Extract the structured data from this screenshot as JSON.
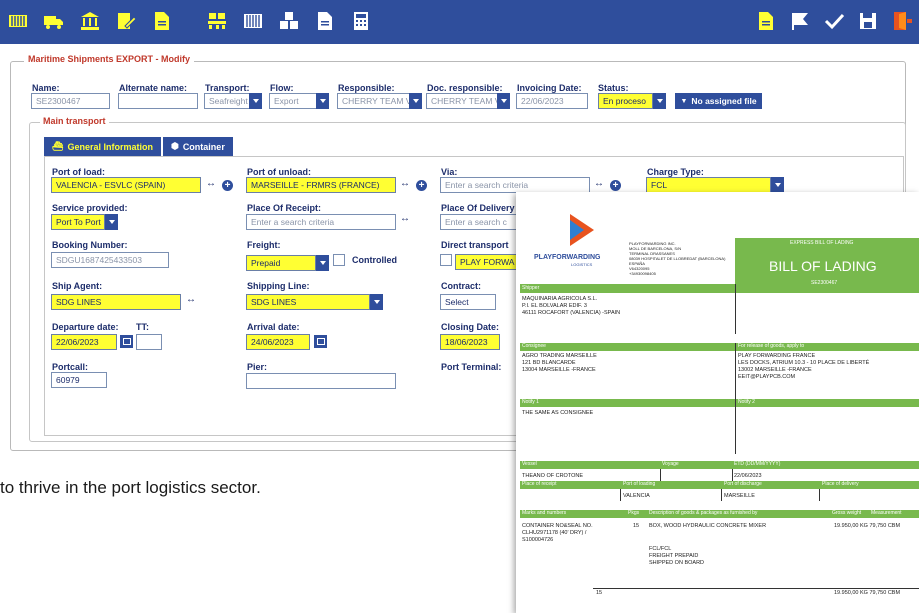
{
  "toolbar": {
    "left_icons": [
      "containers-icon",
      "truck-icon",
      "bank-icon",
      "signed-document-icon",
      "document-icon"
    ],
    "mid_icons": [
      "pallet-icon",
      "barcode-icon",
      "boxes-icon",
      "file-icon",
      "calculator-icon"
    ],
    "right_icons": [
      "document-icon",
      "flag-icon",
      "check-icon",
      "save-icon",
      "exit-icon"
    ]
  },
  "form": {
    "title": "Maritime Shipments EXPORT - Modify",
    "name_label": "Name:",
    "name_value": "SE2300467",
    "alt_name_label": "Alternate name:",
    "alt_name_value": "",
    "transport_label": "Transport:",
    "transport_value": "Seafreight",
    "flow_label": "Flow:",
    "flow_value": "Export",
    "responsible_label": "Responsible:",
    "responsible_value": "CHERRY TEAM VA",
    "doc_responsible_label": "Doc. responsible:",
    "doc_responsible_value": "CHERRY TEAM VA",
    "invoicing_date_label": "Invoicing Date:",
    "invoicing_date_value": "22/06/2023",
    "status_label": "Status:",
    "status_value": "En proceso",
    "no_file_button": "No assigned file",
    "main_transport_title": "Main transport",
    "tab_general": "General Information",
    "tab_container": "Container"
  },
  "fields": {
    "port_of_load_label": "Port of load:",
    "port_of_load_value": "VALENCIA - ESVLC (SPAIN)",
    "port_of_unload_label": "Port of unload:",
    "port_of_unload_value": "MARSEILLE - FRMRS (FRANCE)",
    "via_label": "Via:",
    "via_placeholder": "Enter a search criteria",
    "charge_type_label": "Charge Type:",
    "charge_type_value": "FCL",
    "service_label": "Service provided:",
    "service_value": "Port To Port",
    "place_receipt_label": "Place Of Receipt:",
    "place_receipt_placeholder": "Enter a search criteria",
    "place_delivery_label": "Place Of Delivery",
    "place_delivery_placeholder": "Enter a search c",
    "booking_label": "Booking Number:",
    "booking_value": "SDGU1687425433503",
    "freight_label": "Freight:",
    "freight_value": "Prepaid",
    "controlled_label": "Controlled",
    "direct_transport_label": "Direct transport",
    "direct_transport_value": "PLAY FORWA",
    "ship_agent_label": "Ship Agent:",
    "ship_agent_value": "SDG LINES",
    "shipping_line_label": "Shipping Line:",
    "shipping_line_value": "SDG LINES",
    "contract_label": "Contract:",
    "contract_value": "Select",
    "departure_label": "Departure date:",
    "departure_value": "22/06/2023",
    "tt_label": "TT:",
    "tt_value": "",
    "arrival_label": "Arrival date:",
    "arrival_value": "24/06/2023",
    "closing_label": "Closing Date:",
    "closing_value": "18/06/2023",
    "portcall_label": "Portcall:",
    "portcall_value": "60979",
    "pier_label": "Pier:",
    "pier_value": "",
    "port_terminal_label": "Port Terminal:"
  },
  "body_text": "to thrive in the port logistics sector.",
  "bol": {
    "logo_text": "PLAYFORWARDING",
    "logo_sub": "LOGISTICS",
    "company_lines": [
      "PLAYFORWARDING INC.",
      "MOLL DE BARCELONA, S/N",
      "TERMINAL DRASSANES",
      "08039 HOSPITALET DE LLOBREDAT (BARCELONA)",
      "ESPAÑA",
      "V64320095",
      "+34930098405"
    ],
    "header_small": "EXPRESS BILL OF LADING",
    "header_big": "BILL OF LADING",
    "ref": "SE2300467",
    "shipper_label": "Shipper",
    "shipper_lines": [
      "MAQUINARIA AGRICOLA S.L.",
      "P.I. EL BOLVALAR EDIF. 3",
      "46111 ROCAFORT (VALENCIA) -SPAIN"
    ],
    "consignee_label": "Consignee",
    "consignee_lines": [
      "AGRO TRADING MARSEILLE",
      "121 BD BLANCARDE",
      "13004  MARSEILLE -FRANCE"
    ],
    "release_label": "For release of goods, apply to",
    "release_lines": [
      "PLAY FORWARDING FRANCE",
      "LES DOCKS, ATRIUM 10.3 - 10 PLACE DE LIBERTÉ",
      "13002 MARSEILLE -FRANCE",
      "EEIT@PLAYPCB.COM"
    ],
    "notify1_label": "Notify 1",
    "notify1_value": "THE SAME AS CONSIGNEE",
    "notify2_label": "Notify 2",
    "vessel_label": "Vessel",
    "voyage_label": "Voyage",
    "etd_label": "ETD (DD/MM/YYYY)",
    "vessel_value": "THEANO OF CROTONE",
    "etd_value": "22/06/2023",
    "place_receipt_label": "Place of receipt",
    "port_loading_label": "Port of loading",
    "port_discharge_label": "Port of discharge",
    "place_delivery_label": "Place of delivery",
    "port_loading_value": "VALENCIA",
    "port_discharge_value": "MARSEILLE",
    "marks_label": "Marks and numbers",
    "pkgs_label": "Pkgs",
    "desc_label": "Description of goods & packages as furnished by",
    "gross_label": "Gross weight",
    "measure_label": "Measurement",
    "marks_lines": [
      "CONTAINER NO&SEAL NO.",
      "CLHU2971178 (40' DRY) /",
      "S100004726"
    ],
    "pkgs_value": "15",
    "desc_value": "BOX, WOOD HYDRAULIC CONCRETE MIXER",
    "weight_value": "19.950,00  KG 79,750   CBM",
    "desc_extra": [
      "FCL/FCL",
      "FREIGHT PREPAID",
      "SHIPPED ON BOARD"
    ],
    "total_pkgs": "15",
    "total_weight": "19.950,00  KG 79,750   CBM"
  }
}
